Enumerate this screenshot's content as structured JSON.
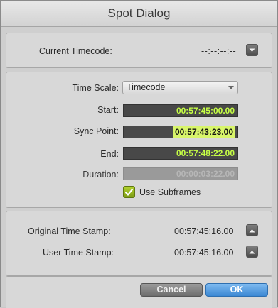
{
  "window": {
    "title": "Spot Dialog"
  },
  "current": {
    "label": "Current Timecode:",
    "value": "--:--:--:--"
  },
  "timescale": {
    "label": "Time Scale:",
    "selected": "Timecode"
  },
  "fields": {
    "start": {
      "label": "Start:",
      "value": "00:57:45:00.00"
    },
    "sync": {
      "label": "Sync Point:",
      "value": "00:57:43:23.00"
    },
    "end": {
      "label": "End:",
      "value": "00:57:48:22.00"
    },
    "duration": {
      "label": "Duration:",
      "value": "00:00:03:22.00"
    }
  },
  "subframes": {
    "label": "Use Subframes",
    "checked": true
  },
  "stamps": {
    "original": {
      "label": "Original Time Stamp:",
      "value": "00:57:45:16.00"
    },
    "user": {
      "label": "User Time Stamp:",
      "value": "00:57:45:16.00"
    }
  },
  "buttons": {
    "cancel": "Cancel",
    "ok": "OK"
  },
  "colors": {
    "timecode_text": "#c6ff45",
    "sync_highlight": "#d8f56a",
    "ok_button": "#3b87d3",
    "checkbox": "#9dbd22"
  }
}
